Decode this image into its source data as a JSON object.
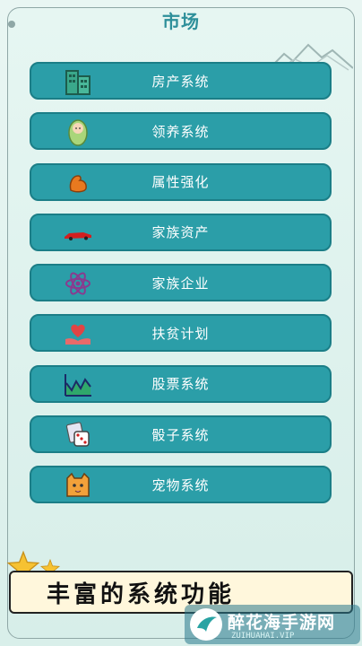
{
  "header": {
    "title": "市场"
  },
  "menu": {
    "items": [
      {
        "label": "房产系统",
        "icon": "building-icon"
      },
      {
        "label": "领养系统",
        "icon": "baby-icon"
      },
      {
        "label": "属性强化",
        "icon": "muscle-arm-icon"
      },
      {
        "label": "家族资产",
        "icon": "car-icon"
      },
      {
        "label": "家族企业",
        "icon": "atom-icon"
      },
      {
        "label": "扶贫计划",
        "icon": "heart-hand-icon"
      },
      {
        "label": "股票系统",
        "icon": "stock-chart-icon"
      },
      {
        "label": "骰子系统",
        "icon": "dice-icon"
      },
      {
        "label": "宠物系统",
        "icon": "pet-cat-icon"
      }
    ]
  },
  "banner": {
    "text": "丰富的系统功能"
  },
  "watermark": {
    "name": "醉花海手游网",
    "url": "ZUIHUAHAI.VIP"
  },
  "colors": {
    "button": "#2b9ea8",
    "title": "#2d8f9a",
    "banner_bg": "#fff7dc"
  }
}
